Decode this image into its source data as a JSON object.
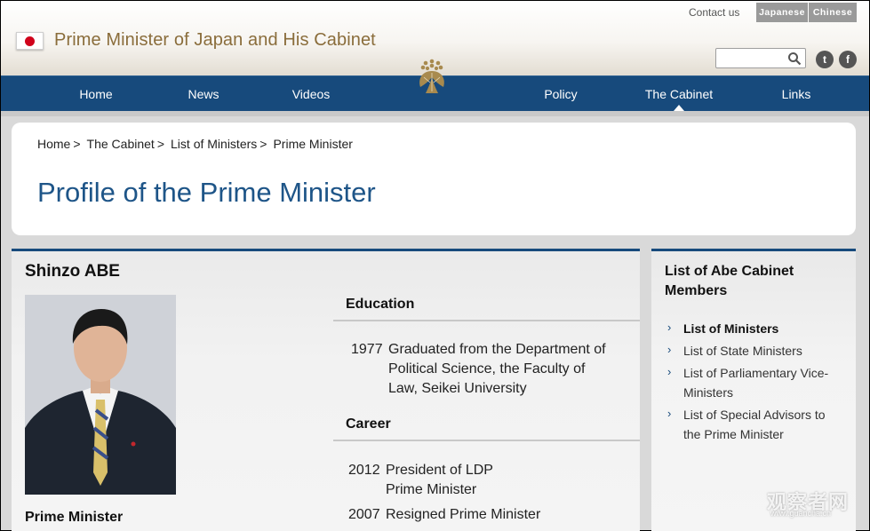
{
  "header": {
    "site_title": "Prime Minister of Japan and His Cabinet",
    "contact": "Contact us",
    "lang_japanese": "Japanese",
    "lang_chinese": "Chinese",
    "search_placeholder": "",
    "twitter_glyph": "t",
    "facebook_glyph": "f"
  },
  "nav": {
    "items": [
      "Home",
      "News",
      "Videos",
      "Policy",
      "The Cabinet",
      "Links"
    ],
    "active": "The Cabinet"
  },
  "breadcrumb": {
    "items": [
      "Home",
      "The Cabinet",
      "List of Ministers",
      "Prime Minister"
    ],
    "sep": ">"
  },
  "page_title": "Profile of the Prime Minister",
  "profile": {
    "name": "Shinzo ABE",
    "role": "Prime Minister",
    "education_heading": "Education",
    "education": [
      {
        "year": "1977",
        "text": "Graduated from the Department of Political Science, the Faculty of Law, Seikei University"
      }
    ],
    "career_heading": "Career",
    "career": [
      {
        "year": "2012",
        "text": "President of LDP Prime Minister"
      },
      {
        "year": "2007",
        "text": "Resigned Prime Minister"
      }
    ]
  },
  "sidebar": {
    "heading": "List of Abe Cabinet Members",
    "items": [
      {
        "label": "List of Ministers",
        "active": true
      },
      {
        "label": "List of State Ministers",
        "active": false
      },
      {
        "label": "List of Parliamentary Vice-Ministers",
        "active": false
      },
      {
        "label": "List of Special Advisors to the Prime Minister",
        "active": false
      }
    ],
    "chevron": "›"
  },
  "watermark": {
    "text": "观察者网",
    "url": "www.guancha.cn"
  },
  "colors": {
    "nav_bg": "#174a7c",
    "title_blue": "#1e5588",
    "gold": "#8a6d3b"
  }
}
